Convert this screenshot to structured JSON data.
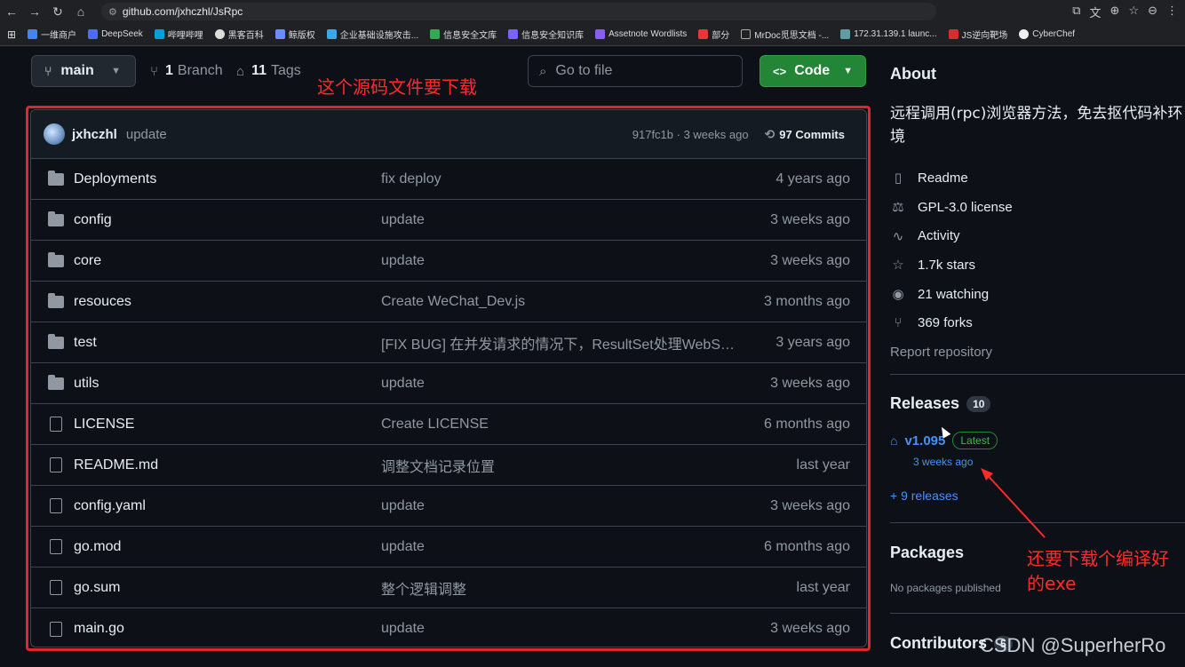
{
  "browser": {
    "url": "github.com/jxhczhl/JsRpc",
    "bookmarks": [
      "一维商户",
      "DeepSeek",
      "哔哩哔哩",
      "黑客百科",
      "鲸版权",
      "企业基础设施攻击...",
      "信息安全文库",
      "信息安全知识库",
      "Assetnote Wordlists",
      "部分",
      "MrDoc觅思文档 -...",
      "172.31.139.1 launc...",
      "JS逆向靶场",
      "CyberChef"
    ]
  },
  "repo_header": {
    "branch": "main",
    "branch_count": "1",
    "branch_label": "Branch",
    "tag_count": "11",
    "tag_label": "Tags",
    "goto_placeholder": "Go to file",
    "code_label": "Code"
  },
  "annotation_top": "这个源码文件要下载",
  "latest_commit": {
    "author": "jxhczhl",
    "message": "update",
    "sha_time": "917fc1b · 3 weeks ago",
    "commits": "97 Commits"
  },
  "files": [
    {
      "type": "folder",
      "name": "Deployments",
      "message": "fix deploy",
      "date": "4 years ago"
    },
    {
      "type": "folder",
      "name": "config",
      "message": "update",
      "date": "3 weeks ago"
    },
    {
      "type": "folder",
      "name": "core",
      "message": "update",
      "date": "3 weeks ago"
    },
    {
      "type": "folder",
      "name": "resouces",
      "message": "Create WeChat_Dev.js",
      "date": "3 months ago"
    },
    {
      "type": "folder",
      "name": "test",
      "message": "[FIX BUG] 在并发请求的情况下，ResultSet处理WebSoc...",
      "date": "3 years ago"
    },
    {
      "type": "folder",
      "name": "utils",
      "message": "update",
      "date": "3 weeks ago"
    },
    {
      "type": "file",
      "name": "LICENSE",
      "message": "Create LICENSE",
      "date": "6 months ago"
    },
    {
      "type": "file",
      "name": "README.md",
      "message": "调整文档记录位置",
      "date": "last year"
    },
    {
      "type": "file",
      "name": "config.yaml",
      "message": "update",
      "date": "3 weeks ago"
    },
    {
      "type": "file",
      "name": "go.mod",
      "message": "update",
      "date": "6 months ago"
    },
    {
      "type": "file",
      "name": "go.sum",
      "message": "整个逻辑调整",
      "date": "last year"
    },
    {
      "type": "file",
      "name": "main.go",
      "message": "update",
      "date": "3 weeks ago"
    }
  ],
  "about": {
    "title": "About",
    "description": "远程调用(rpc)浏览器方法，免去抠代码补环境",
    "items": [
      {
        "icon": "book-icon",
        "label": "Readme"
      },
      {
        "icon": "law-icon",
        "label": "GPL-3.0 license"
      },
      {
        "icon": "pulse-icon",
        "label": "Activity"
      },
      {
        "icon": "star-icon",
        "label": "1.7k stars"
      },
      {
        "icon": "eye-icon",
        "label": "21 watching"
      },
      {
        "icon": "fork-icon",
        "label": "369 forks"
      },
      {
        "icon": "",
        "label": "Report repository"
      }
    ]
  },
  "releases": {
    "title": "Releases",
    "count": "10",
    "latest_version": "v1.095",
    "latest_badge": "Latest",
    "latest_date": "3 weeks ago",
    "more": "+ 9 releases"
  },
  "packages": {
    "title": "Packages",
    "empty": "No packages published"
  },
  "contributors": {
    "title": "Contributors",
    "count": "5"
  },
  "annotation_side": "还要下载个编译好的exe",
  "watermark": "CSDN @SuperherRo"
}
